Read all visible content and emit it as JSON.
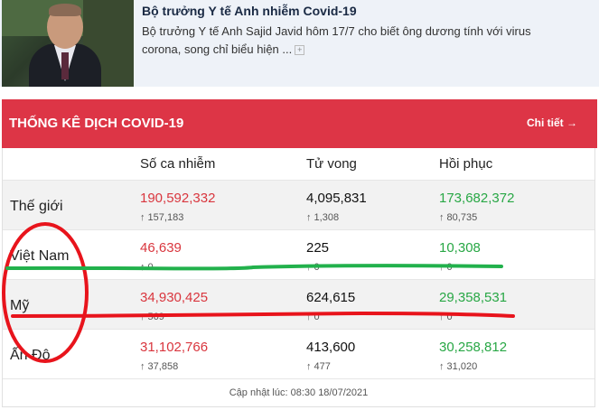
{
  "news": {
    "title": "Bộ trưởng Y tế Anh nhiễm Covid-19",
    "description": "Bộ trưởng Y tế Anh Sajid Javid hôm 17/7 cho biết ông dương tính với virus corona, song chỉ biểu hiện ...",
    "expand_icon": "plus-icon",
    "expand_glyph": "+"
  },
  "stats": {
    "title": "THỐNG KÊ DỊCH COVID-19",
    "detail_link": "Chi tiết →",
    "header_color": "#dd3546",
    "columns": [
      "Số ca nhiễm",
      "Tử vong",
      "Hồi phục"
    ],
    "rows": [
      {
        "country": "Thế giới",
        "cases": "190,592,332",
        "cases_delta": "↑ 157,183",
        "deaths": "4,095,831",
        "deaths_delta": "↑ 1,308",
        "recovered": "173,682,372",
        "recovered_delta": "↑ 80,735"
      },
      {
        "country": "Việt Nam",
        "cases": "46,639",
        "cases_delta": "↑ 0",
        "deaths": "225",
        "deaths_delta": "↑ 0",
        "recovered": "10,308",
        "recovered_delta": "↑ 0"
      },
      {
        "country": "Mỹ",
        "cases": "34,930,425",
        "cases_delta": "↑ 569",
        "deaths": "624,615",
        "deaths_delta": "↑ 0",
        "recovered": "29,358,531",
        "recovered_delta": "↑ 0"
      },
      {
        "country": "Ấn Độ",
        "cases": "31,102,766",
        "cases_delta": "↑ 37,858",
        "deaths": "413,600",
        "deaths_delta": "↑ 477",
        "recovered": "30,258,812",
        "recovered_delta": "↑ 31,020"
      }
    ],
    "updated": "Cập nhật lúc: 08:30 18/07/2021"
  },
  "annotations": {
    "circle_color": "#e8141c",
    "green_line_color": "#22b14c",
    "red_line_color": "#e8141c"
  }
}
